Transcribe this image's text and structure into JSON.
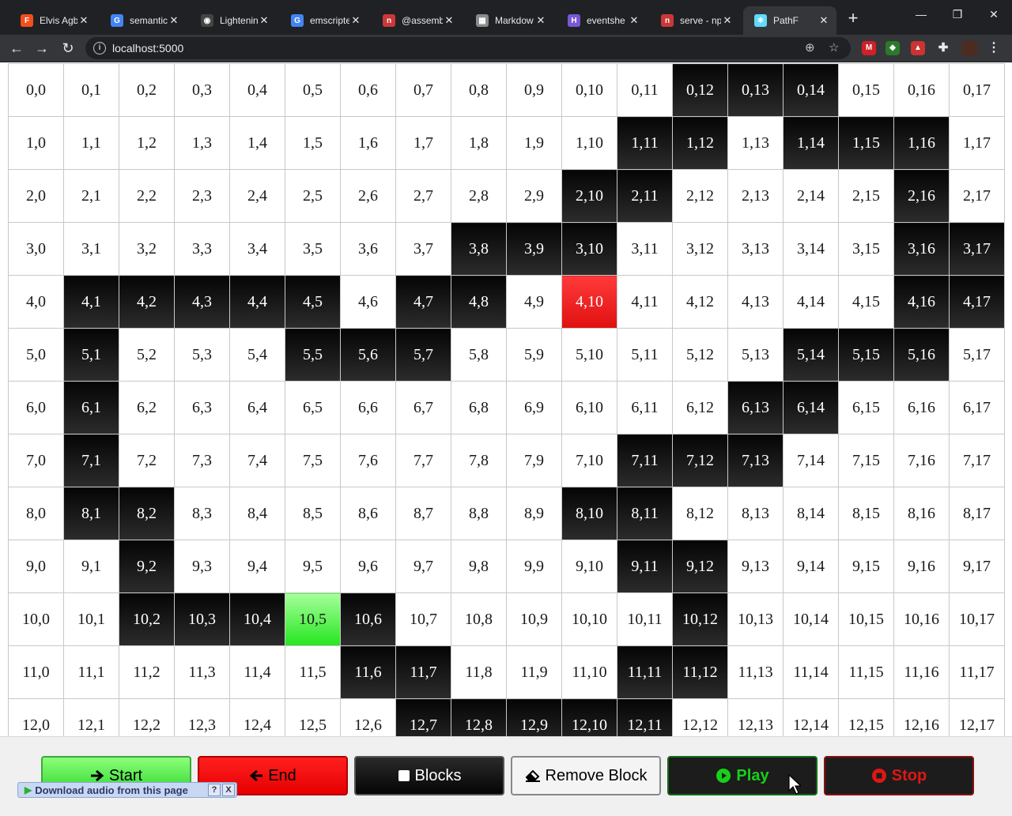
{
  "browser": {
    "tabs": [
      {
        "label": "Elvis Agbe",
        "icon": "figma-icon",
        "color": "#f24e1e",
        "glyph": "F"
      },
      {
        "label": "semantic",
        "icon": "google-icon",
        "color": "#4285f4",
        "glyph": "G"
      },
      {
        "label": "Lightening",
        "icon": "github-icon",
        "color": "#444444",
        "glyph": "◉"
      },
      {
        "label": "emscripte",
        "icon": "google-icon",
        "color": "#4285f4",
        "glyph": "G"
      },
      {
        "label": "@assemb",
        "icon": "npm-icon",
        "color": "#cb3837",
        "glyph": "n"
      },
      {
        "label": "Markdow",
        "icon": "markdown-icon",
        "color": "#8a8a8a",
        "glyph": "▦"
      },
      {
        "label": "eventshe",
        "icon": "heroku-icon",
        "color": "#7957d5",
        "glyph": "H"
      },
      {
        "label": "serve - np",
        "icon": "npm-icon",
        "color": "#cb3837",
        "glyph": "n"
      },
      {
        "label": "PathF",
        "icon": "react-icon",
        "color": "#61dafb",
        "glyph": "⚛"
      }
    ],
    "active_tab": 8,
    "url": "localhost:5000",
    "window_controls": {
      "minimize": "—",
      "maximize": "❐",
      "close": "✕"
    }
  },
  "grid": {
    "rows": 13,
    "cols": 18,
    "blocks": [
      "0,12",
      "0,13",
      "0,14",
      "1,11",
      "1,12",
      "1,14",
      "1,15",
      "1,16",
      "2,10",
      "2,11",
      "2,16",
      "3,8",
      "3,9",
      "3,10",
      "3,16",
      "3,17",
      "4,1",
      "4,2",
      "4,3",
      "4,4",
      "4,5",
      "4,7",
      "4,8",
      "4,16",
      "4,17",
      "5,1",
      "5,5",
      "5,6",
      "5,7",
      "5,14",
      "5,15",
      "5,16",
      "6,1",
      "6,13",
      "6,14",
      "7,1",
      "7,11",
      "7,12",
      "7,13",
      "8,1",
      "8,2",
      "8,10",
      "8,11",
      "9,2",
      "9,11",
      "9,12",
      "10,2",
      "10,3",
      "10,4",
      "10,6",
      "10,12",
      "11,6",
      "11,7",
      "11,11",
      "11,12",
      "12,7",
      "12,8",
      "12,9",
      "12,10",
      "12,11"
    ],
    "start": "10,5",
    "end": "4,10"
  },
  "controls": {
    "start_label": "Start",
    "end_label": "End",
    "blocks_label": "Blocks",
    "remove_label": "Remove Block",
    "play_label": "Play",
    "stop_label": "Stop"
  },
  "download_bar": {
    "text": "Download audio from this page",
    "help": "?",
    "close": "X"
  },
  "colors": {
    "block": "#111111",
    "start": "#33ee33",
    "end": "#ee1111",
    "play": "#17d017",
    "stop": "#e01616"
  }
}
